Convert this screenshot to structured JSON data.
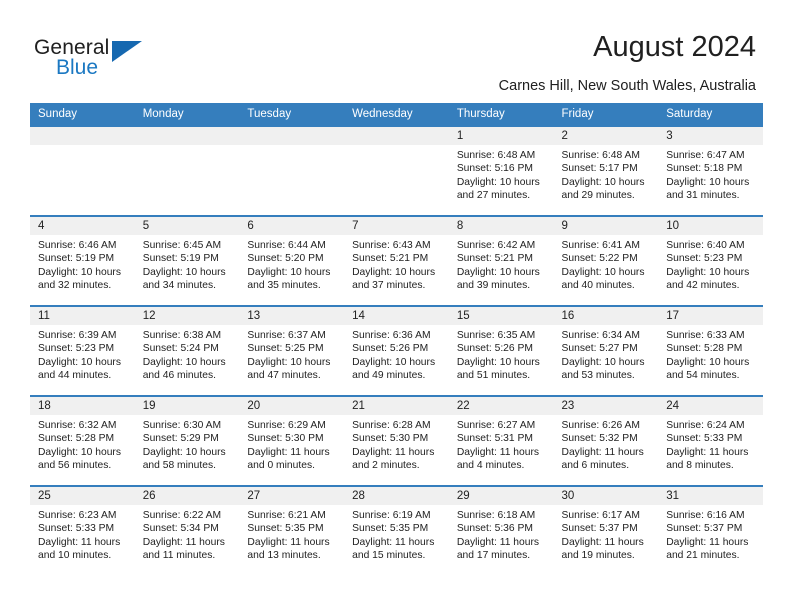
{
  "brand": {
    "name_top": "General",
    "name_bottom": "Blue",
    "triangle_icon": "triangle-logo-icon",
    "accent_color": "#1b78c2"
  },
  "header": {
    "title": "August 2024",
    "subtitle": "Carnes Hill, New South Wales, Australia",
    "header_bg_color": "#357ebd",
    "daynum_bg_color": "#f0f0f0"
  },
  "weekday_headers": [
    "Sunday",
    "Monday",
    "Tuesday",
    "Wednesday",
    "Thursday",
    "Friday",
    "Saturday"
  ],
  "weeks": [
    [
      {
        "day": "",
        "empty": true
      },
      {
        "day": "",
        "empty": true
      },
      {
        "day": "",
        "empty": true
      },
      {
        "day": "",
        "empty": true
      },
      {
        "day": "1",
        "sunrise": "Sunrise: 6:48 AM",
        "sunset": "Sunset: 5:16 PM",
        "daylight1": "Daylight: 10 hours",
        "daylight2": "and 27 minutes."
      },
      {
        "day": "2",
        "sunrise": "Sunrise: 6:48 AM",
        "sunset": "Sunset: 5:17 PM",
        "daylight1": "Daylight: 10 hours",
        "daylight2": "and 29 minutes."
      },
      {
        "day": "3",
        "sunrise": "Sunrise: 6:47 AM",
        "sunset": "Sunset: 5:18 PM",
        "daylight1": "Daylight: 10 hours",
        "daylight2": "and 31 minutes."
      }
    ],
    [
      {
        "day": "4",
        "sunrise": "Sunrise: 6:46 AM",
        "sunset": "Sunset: 5:19 PM",
        "daylight1": "Daylight: 10 hours",
        "daylight2": "and 32 minutes."
      },
      {
        "day": "5",
        "sunrise": "Sunrise: 6:45 AM",
        "sunset": "Sunset: 5:19 PM",
        "daylight1": "Daylight: 10 hours",
        "daylight2": "and 34 minutes."
      },
      {
        "day": "6",
        "sunrise": "Sunrise: 6:44 AM",
        "sunset": "Sunset: 5:20 PM",
        "daylight1": "Daylight: 10 hours",
        "daylight2": "and 35 minutes."
      },
      {
        "day": "7",
        "sunrise": "Sunrise: 6:43 AM",
        "sunset": "Sunset: 5:21 PM",
        "daylight1": "Daylight: 10 hours",
        "daylight2": "and 37 minutes."
      },
      {
        "day": "8",
        "sunrise": "Sunrise: 6:42 AM",
        "sunset": "Sunset: 5:21 PM",
        "daylight1": "Daylight: 10 hours",
        "daylight2": "and 39 minutes."
      },
      {
        "day": "9",
        "sunrise": "Sunrise: 6:41 AM",
        "sunset": "Sunset: 5:22 PM",
        "daylight1": "Daylight: 10 hours",
        "daylight2": "and 40 minutes."
      },
      {
        "day": "10",
        "sunrise": "Sunrise: 6:40 AM",
        "sunset": "Sunset: 5:23 PM",
        "daylight1": "Daylight: 10 hours",
        "daylight2": "and 42 minutes."
      }
    ],
    [
      {
        "day": "11",
        "sunrise": "Sunrise: 6:39 AM",
        "sunset": "Sunset: 5:23 PM",
        "daylight1": "Daylight: 10 hours",
        "daylight2": "and 44 minutes."
      },
      {
        "day": "12",
        "sunrise": "Sunrise: 6:38 AM",
        "sunset": "Sunset: 5:24 PM",
        "daylight1": "Daylight: 10 hours",
        "daylight2": "and 46 minutes."
      },
      {
        "day": "13",
        "sunrise": "Sunrise: 6:37 AM",
        "sunset": "Sunset: 5:25 PM",
        "daylight1": "Daylight: 10 hours",
        "daylight2": "and 47 minutes."
      },
      {
        "day": "14",
        "sunrise": "Sunrise: 6:36 AM",
        "sunset": "Sunset: 5:26 PM",
        "daylight1": "Daylight: 10 hours",
        "daylight2": "and 49 minutes."
      },
      {
        "day": "15",
        "sunrise": "Sunrise: 6:35 AM",
        "sunset": "Sunset: 5:26 PM",
        "daylight1": "Daylight: 10 hours",
        "daylight2": "and 51 minutes."
      },
      {
        "day": "16",
        "sunrise": "Sunrise: 6:34 AM",
        "sunset": "Sunset: 5:27 PM",
        "daylight1": "Daylight: 10 hours",
        "daylight2": "and 53 minutes."
      },
      {
        "day": "17",
        "sunrise": "Sunrise: 6:33 AM",
        "sunset": "Sunset: 5:28 PM",
        "daylight1": "Daylight: 10 hours",
        "daylight2": "and 54 minutes."
      }
    ],
    [
      {
        "day": "18",
        "sunrise": "Sunrise: 6:32 AM",
        "sunset": "Sunset: 5:28 PM",
        "daylight1": "Daylight: 10 hours",
        "daylight2": "and 56 minutes."
      },
      {
        "day": "19",
        "sunrise": "Sunrise: 6:30 AM",
        "sunset": "Sunset: 5:29 PM",
        "daylight1": "Daylight: 10 hours",
        "daylight2": "and 58 minutes."
      },
      {
        "day": "20",
        "sunrise": "Sunrise: 6:29 AM",
        "sunset": "Sunset: 5:30 PM",
        "daylight1": "Daylight: 11 hours",
        "daylight2": "and 0 minutes."
      },
      {
        "day": "21",
        "sunrise": "Sunrise: 6:28 AM",
        "sunset": "Sunset: 5:30 PM",
        "daylight1": "Daylight: 11 hours",
        "daylight2": "and 2 minutes."
      },
      {
        "day": "22",
        "sunrise": "Sunrise: 6:27 AM",
        "sunset": "Sunset: 5:31 PM",
        "daylight1": "Daylight: 11 hours",
        "daylight2": "and 4 minutes."
      },
      {
        "day": "23",
        "sunrise": "Sunrise: 6:26 AM",
        "sunset": "Sunset: 5:32 PM",
        "daylight1": "Daylight: 11 hours",
        "daylight2": "and 6 minutes."
      },
      {
        "day": "24",
        "sunrise": "Sunrise: 6:24 AM",
        "sunset": "Sunset: 5:33 PM",
        "daylight1": "Daylight: 11 hours",
        "daylight2": "and 8 minutes."
      }
    ],
    [
      {
        "day": "25",
        "sunrise": "Sunrise: 6:23 AM",
        "sunset": "Sunset: 5:33 PM",
        "daylight1": "Daylight: 11 hours",
        "daylight2": "and 10 minutes."
      },
      {
        "day": "26",
        "sunrise": "Sunrise: 6:22 AM",
        "sunset": "Sunset: 5:34 PM",
        "daylight1": "Daylight: 11 hours",
        "daylight2": "and 11 minutes."
      },
      {
        "day": "27",
        "sunrise": "Sunrise: 6:21 AM",
        "sunset": "Sunset: 5:35 PM",
        "daylight1": "Daylight: 11 hours",
        "daylight2": "and 13 minutes."
      },
      {
        "day": "28",
        "sunrise": "Sunrise: 6:19 AM",
        "sunset": "Sunset: 5:35 PM",
        "daylight1": "Daylight: 11 hours",
        "daylight2": "and 15 minutes."
      },
      {
        "day": "29",
        "sunrise": "Sunrise: 6:18 AM",
        "sunset": "Sunset: 5:36 PM",
        "daylight1": "Daylight: 11 hours",
        "daylight2": "and 17 minutes."
      },
      {
        "day": "30",
        "sunrise": "Sunrise: 6:17 AM",
        "sunset": "Sunset: 5:37 PM",
        "daylight1": "Daylight: 11 hours",
        "daylight2": "and 19 minutes."
      },
      {
        "day": "31",
        "sunrise": "Sunrise: 6:16 AM",
        "sunset": "Sunset: 5:37 PM",
        "daylight1": "Daylight: 11 hours",
        "daylight2": "and 21 minutes."
      }
    ]
  ]
}
